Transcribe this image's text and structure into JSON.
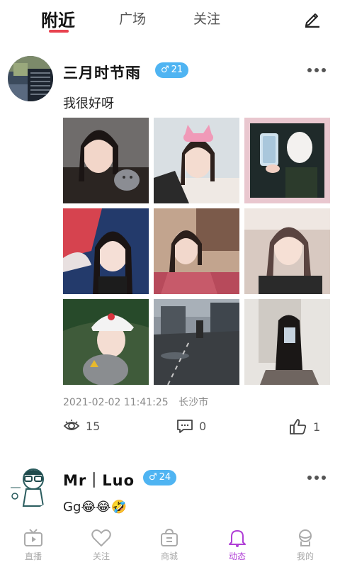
{
  "top_tabs": [
    {
      "label": "附近",
      "active": true
    },
    {
      "label": "广场",
      "active": false
    },
    {
      "label": "关注",
      "active": false
    }
  ],
  "posts": [
    {
      "username": "三月时节雨",
      "gender": "♂",
      "age": "21",
      "text": "我很好呀",
      "time": "2021-02-02 11:41:25",
      "location": "长沙市",
      "views": "15",
      "comments": "0",
      "likes": "1"
    },
    {
      "username": "Mr｜Luo",
      "gender": "♂",
      "age": "24",
      "text": "Gg😂😂🤣"
    }
  ],
  "bottom_nav": [
    {
      "label": "直播",
      "icon": "tv-icon",
      "active": false
    },
    {
      "label": "关注",
      "icon": "heart-icon",
      "active": false
    },
    {
      "label": "商城",
      "icon": "shop-bag-icon",
      "active": false
    },
    {
      "label": "动态",
      "icon": "bell-icon",
      "active": true
    },
    {
      "label": "我的",
      "icon": "profile-icon",
      "active": false
    }
  ],
  "colors": {
    "accent_red": "#e8424f",
    "badge_blue": "#4fb4f2",
    "active_nav": "#b03fd6"
  }
}
